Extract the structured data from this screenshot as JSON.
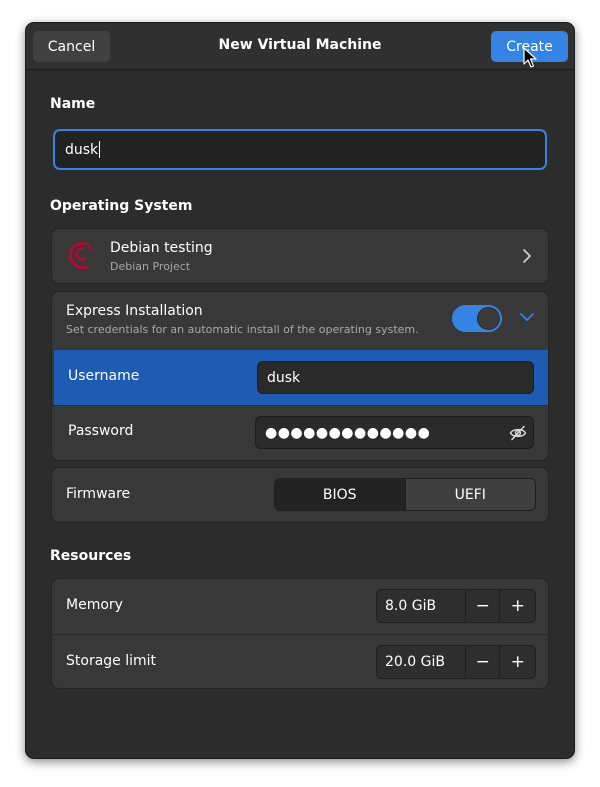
{
  "header": {
    "title": "New Virtual Machine",
    "cancel_label": "Cancel",
    "create_label": "Create"
  },
  "name_section": {
    "label": "Name",
    "value": "dusk"
  },
  "os_section": {
    "label": "Operating System",
    "os_name": "Debian testing",
    "os_vendor": "Debian Project",
    "logo_icon": "debian-swirl-icon",
    "logo_color": "#c70036"
  },
  "express": {
    "title": "Express Installation",
    "subtitle": "Set credentials for an automatic install of the operating system.",
    "enabled": true,
    "username_label": "Username",
    "username_value": "dusk",
    "password_label": "Password",
    "password_mask": "●●●●●●●●●●●●●"
  },
  "firmware": {
    "label": "Firmware",
    "options": [
      "BIOS",
      "UEFI"
    ],
    "selected": "BIOS"
  },
  "resources": {
    "label": "Resources",
    "memory_label": "Memory",
    "memory_value": "8.0 GiB",
    "storage_label": "Storage limit",
    "storage_value": "20.0 GiB",
    "minus": "−",
    "plus": "+"
  },
  "colors": {
    "accent": "#3584e4",
    "selected_row": "#1e5bb3",
    "window_bg": "#2c2c2c",
    "card_bg": "#383838"
  }
}
